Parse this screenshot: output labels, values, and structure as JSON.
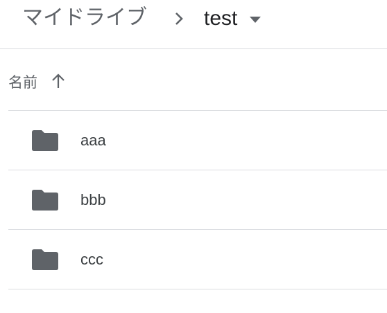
{
  "breadcrumb": {
    "root_label": "マイドライブ",
    "current_label": "test",
    "separator_icon": "chevron-right-icon",
    "dropdown_icon": "arrow-drop-down-icon"
  },
  "list_header": {
    "name_column_label": "名前",
    "sort_icon": "arrow-up-icon"
  },
  "files": [
    {
      "name": "aaa",
      "type": "folder"
    },
    {
      "name": "bbb",
      "type": "folder"
    },
    {
      "name": "ccc",
      "type": "folder"
    }
  ],
  "colors": {
    "icon_gray": "#5f6368",
    "divider": "#dadce0",
    "text_primary": "#202124"
  }
}
